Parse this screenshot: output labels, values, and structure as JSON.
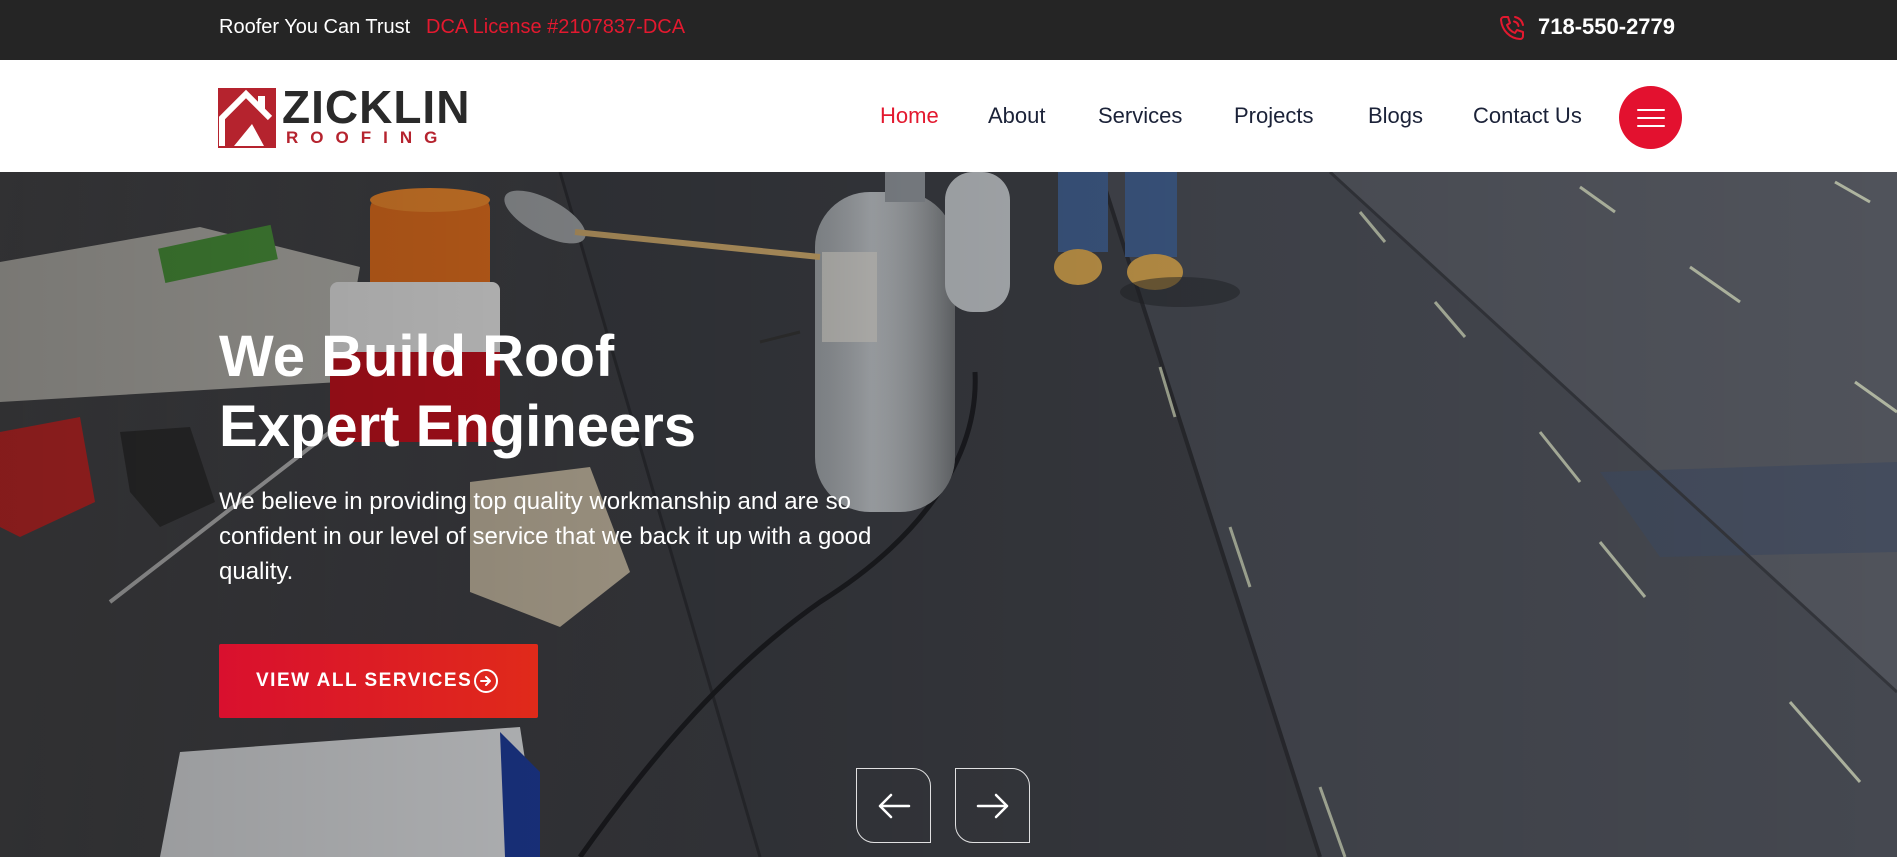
{
  "topbar": {
    "tagline": "Roofer You Can Trust",
    "license": "DCA License #2107837-DCA",
    "phone": "718-550-2779",
    "phone_icon": "phone-icon"
  },
  "header": {
    "logo": {
      "word": "ZICKLIN",
      "sub": "ROOFING"
    },
    "nav": [
      {
        "label": "Home",
        "active": true
      },
      {
        "label": "About"
      },
      {
        "label": "Services"
      },
      {
        "label": "Projects"
      },
      {
        "label": "Blogs"
      },
      {
        "label": "Contact Us"
      }
    ],
    "menu_icon": "hamburger-menu-icon"
  },
  "hero": {
    "title_line1": "We Build Roof",
    "title_line2": "Expert Engineers",
    "description": "We believe in providing top quality workmanship and are so confident in our level of service that we back it up with a good quality.",
    "cta_label": "VIEW ALL SERVICES",
    "prev_icon": "arrow-left-icon",
    "next_icon": "arrow-right-icon"
  },
  "colors": {
    "accent": "#e3192f",
    "topbar_bg": "#252525",
    "nav_text": "#1b2238"
  }
}
